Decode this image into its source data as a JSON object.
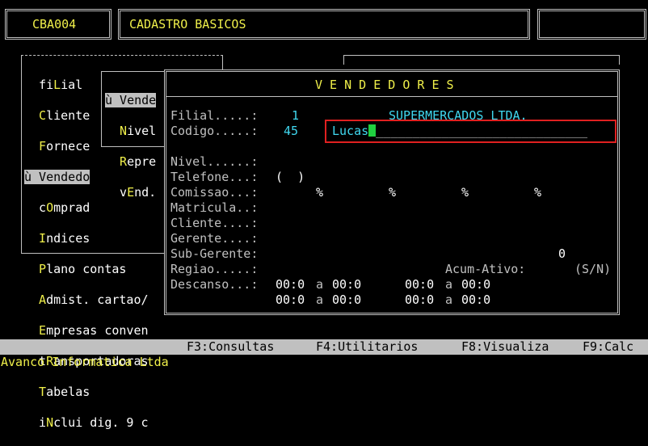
{
  "header": {
    "program_code": "CBA004",
    "title": "CADASTRO BASICOS",
    "right_box": ""
  },
  "main_menu": {
    "items": [
      {
        "hot": "",
        "label": "fiLial"
      },
      {
        "label": "Cliente"
      },
      {
        "label": "Fornece"
      },
      {
        "label": "ù Vendedo"
      },
      {
        "label": "cOmprad"
      },
      {
        "label": "Indices"
      },
      {
        "label": "Plano contas"
      },
      {
        "label": "Admist. cartao/"
      },
      {
        "label": "Empresas conven"
      },
      {
        "label": "tRansportadoras"
      },
      {
        "label": "Tabelas"
      },
      {
        "label": "iNclui dig. 9 c"
      }
    ]
  },
  "sub_menu": {
    "items": [
      {
        "label": "ù Vende"
      },
      {
        "label": "Nivel"
      },
      {
        "label": "Repre"
      },
      {
        "label": "vEnd."
      }
    ]
  },
  "form": {
    "title": "V E N D E D O R E S",
    "filial_label": "Filial.....:",
    "filial_value": "1",
    "filial_name": "SUPERMERCADOS LTDA.",
    "codigo_label": "Codigo.....:",
    "codigo_value": "45",
    "nome_value": "Lucas",
    "nome_fill": "_____________________________",
    "nivel_label": "Nivel......:",
    "telefone_label": "Telefone...:",
    "telefone_value": "(  )",
    "comissao_label": "Comissao...:",
    "pct": "%",
    "matricula_label": "Matricula..:",
    "cliente_label": "Cliente....:",
    "gerente_label": "Gerente....:",
    "subgerente_label": "Sub-Gerente:",
    "subgerente_value": "0",
    "regiao_label": "Regiao.....:",
    "acum_label": "Acum-Ativo:",
    "acum_options": "(S/N)",
    "descanso_label": "Descanso...:",
    "time_value": "00:0",
    "a_word": "a"
  },
  "status_bar": {
    "f3": "F3:Consultas",
    "f4": "F4:Utilitarios",
    "f8": "F8:Visualiza",
    "f9": "F9:Calc"
  },
  "footer": {
    "company": "Avanco Informatica Ltda"
  }
}
